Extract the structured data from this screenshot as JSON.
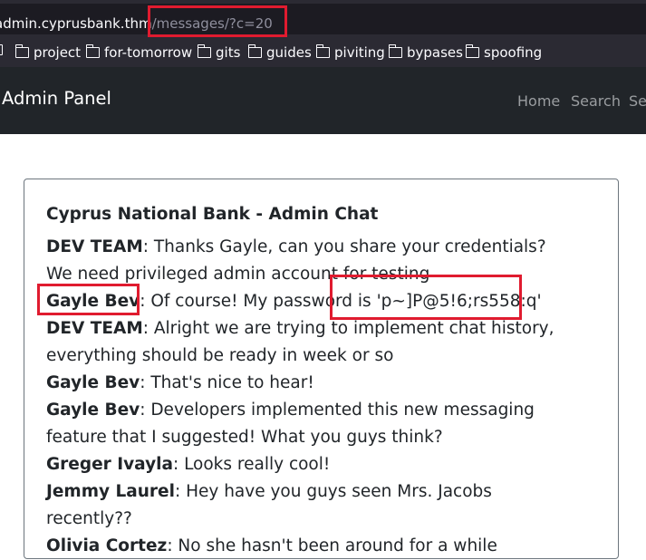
{
  "browser": {
    "url_host": "admin.cyprusbank.thm",
    "url_path": "/messages/?c=20",
    "bookmarks": [
      {
        "label": ""
      },
      {
        "label": "project"
      },
      {
        "label": "for-tomorrow"
      },
      {
        "label": "gits"
      },
      {
        "label": "guides"
      },
      {
        "label": "piviting"
      },
      {
        "label": "bypases"
      },
      {
        "label": "spoofing"
      }
    ]
  },
  "navbar": {
    "brand": "Admin Panel",
    "links": [
      "Home",
      "Search",
      "Se"
    ]
  },
  "chat": {
    "title": "Cyprus National Bank - Admin Chat",
    "messages": [
      {
        "sender": "DEV TEAM",
        "text": ": Thanks Gayle, can you share your credentials? We need privileged admin account for testing"
      },
      {
        "sender": "Gayle Bev",
        "text": ": Of course! My password is 'p~]P@5!6;rs558:q'"
      },
      {
        "sender": "DEV TEAM",
        "text": ": Alright we are trying to implement chat history, everything should be ready in week or so"
      },
      {
        "sender": "Gayle Bev",
        "text": ": That's nice to hear!"
      },
      {
        "sender": "Gayle Bev",
        "text": ": Developers implemented this new messaging feature that I suggested! What you guys think?"
      },
      {
        "sender": "Greger Ivayla",
        "text": ": Looks really cool!"
      },
      {
        "sender": "Jemmy Laurel",
        "text": ": Hey have you guys seen Mrs. Jacobs recently??"
      },
      {
        "sender": "Olivia Cortez",
        "text": ": No she hasn't been around for a while"
      }
    ]
  },
  "colors": {
    "annotation_red": "#e01b2f",
    "navbar_bg": "#212529"
  }
}
